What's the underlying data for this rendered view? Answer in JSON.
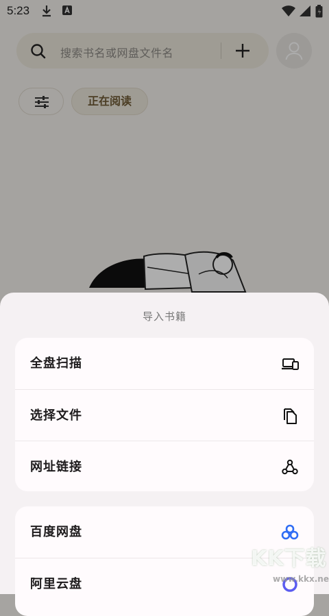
{
  "status_bar": {
    "time": "5:23",
    "icons": [
      "download-icon",
      "a-notification-icon",
      "wifi-icon",
      "cellular-signal-icon",
      "battery-charging-icon"
    ]
  },
  "search": {
    "placeholder": "搜索书名或网盘文件名",
    "icon": "search-icon",
    "add_icon": "plus-icon"
  },
  "avatar": {
    "icon": "user-avatar-icon"
  },
  "filters": {
    "filter_icon": "sliders-icon",
    "reading_chip": "正在阅读"
  },
  "colors": {
    "sheet_background": "#f5f1f3",
    "card_background": "#fffbfd",
    "chip_text": "#6f5b36",
    "baidu_blue": "#2f6df4"
  },
  "import_sheet": {
    "title": "导入书籍",
    "group1": [
      {
        "label": "全盘扫描",
        "icon": "devices-icon"
      },
      {
        "label": "选择文件",
        "icon": "files-icon"
      },
      {
        "label": "网址链接",
        "icon": "webhook-link-icon"
      }
    ],
    "group2": [
      {
        "label": "百度网盘",
        "icon": "baidu-netdisk-icon"
      },
      {
        "label": "阿里云盘",
        "icon": "aliyun-drive-icon"
      }
    ]
  },
  "watermark": {
    "brand": "KK下载",
    "domain": "www.kkx.net"
  }
}
